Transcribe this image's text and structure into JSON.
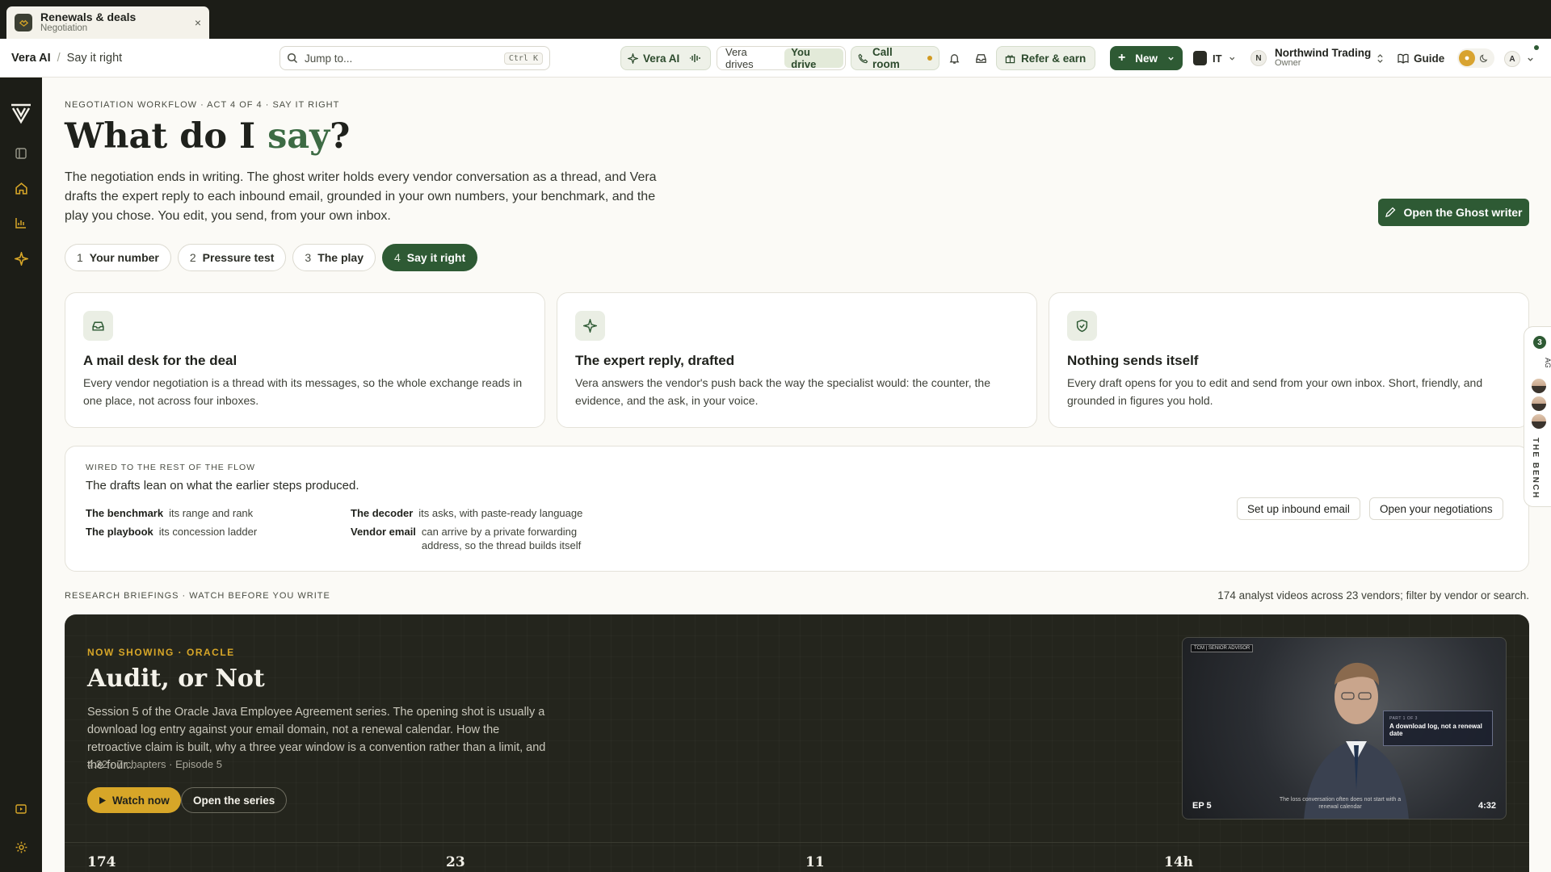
{
  "tab": {
    "title": "Renewals & deals",
    "subtitle": "Negotiation",
    "close": "×"
  },
  "header": {
    "breadcrumb": {
      "root": "Vera AI",
      "sep": "/",
      "current": "Say it right"
    },
    "search": {
      "placeholder": "Jump to...",
      "shortcut": "Ctrl K"
    },
    "vera_ai": "Vera AI",
    "drive": {
      "vera": "Vera drives",
      "you": "You drive"
    },
    "call_room": "Call room",
    "refer": "Refer & earn",
    "new": "New",
    "tenant": "IT",
    "org": {
      "initial": "N",
      "name": "Northwind Trading",
      "role": "Owner"
    },
    "guide": "Guide",
    "account_initial": "A"
  },
  "hero": {
    "eyebrow": "NEGOTIATION WORKFLOW · ACT 4 OF 4 · SAY IT RIGHT",
    "title_pre": "What do I ",
    "title_accent": "say",
    "title_post": "?",
    "lead": "The negotiation ends in writing. The ghost writer holds every vendor conversation as a thread, and Vera drafts the expert reply to each inbound email, grounded in your own numbers, your benchmark, and the play you chose. You edit, you send, from your own inbox.",
    "cta": "Open the Ghost writer"
  },
  "steps": [
    {
      "n": "1",
      "label": "Your number"
    },
    {
      "n": "2",
      "label": "Pressure test"
    },
    {
      "n": "3",
      "label": "The play"
    },
    {
      "n": "4",
      "label": "Say it right"
    }
  ],
  "cards": [
    {
      "icon": "inbox-icon",
      "title": "A mail desk for the deal",
      "body": "Every vendor negotiation is a thread with its messages, so the whole exchange reads in one place, not across four inboxes."
    },
    {
      "icon": "sparkle-icon",
      "title": "The expert reply, drafted",
      "body": "Vera answers the vendor's push back the way the specialist would: the counter, the evidence, and the ask, in your voice."
    },
    {
      "icon": "shield-check-icon",
      "title": "Nothing sends itself",
      "body": "Every draft opens for you to edit and send from your own inbox. Short, friendly, and grounded in figures you hold."
    }
  ],
  "wired": {
    "eyebrow": "WIRED TO THE REST OF THE FLOW",
    "lead": "The drafts lean on what the earlier steps produced.",
    "items": [
      {
        "k": "The benchmark",
        "v": "its range and rank"
      },
      {
        "k": "The playbook",
        "v": "its concession ladder"
      },
      {
        "k": "The decoder",
        "v": "its asks, with paste-ready language"
      },
      {
        "k": "Vendor email",
        "v": "can arrive by a private forwarding address, so the thread builds itself"
      }
    ],
    "btn_inbound": "Set up inbound email",
    "btn_negotiations": "Open your negotiations"
  },
  "research": {
    "eyebrow": "RESEARCH BRIEFINGS · WATCH BEFORE YOU WRITE",
    "meta": "174 analyst videos across 23 vendors; filter by vendor or search."
  },
  "feature": {
    "now": "NOW SHOWING · ORACLE",
    "title": "Audit, or Not",
    "desc": "Session 5 of the Oracle Java Employee Agreement series. The opening shot is usually a download log entry against your email domain, not a renewal calendar. How the retroactive claim is built, why a three year window is a convention rather than a limit, and the four...",
    "meta": "4:32 · 7 chapters · Episode 5",
    "watch": "Watch now",
    "series": "Open the series",
    "video": {
      "tag": "TCM | SENIOR ADVISOR",
      "card_kicker": "PART 1 OF 3",
      "card_title": "A download log, not a renewal date",
      "caption": "The loss conversation often does not start with a renewal calendar",
      "ep": "EP 5",
      "duration": "4:32"
    },
    "stats": [
      "174",
      "23",
      "11",
      "14h"
    ]
  },
  "bench": {
    "count": "3",
    "label": "THE BENCH",
    "peek": "AG"
  }
}
